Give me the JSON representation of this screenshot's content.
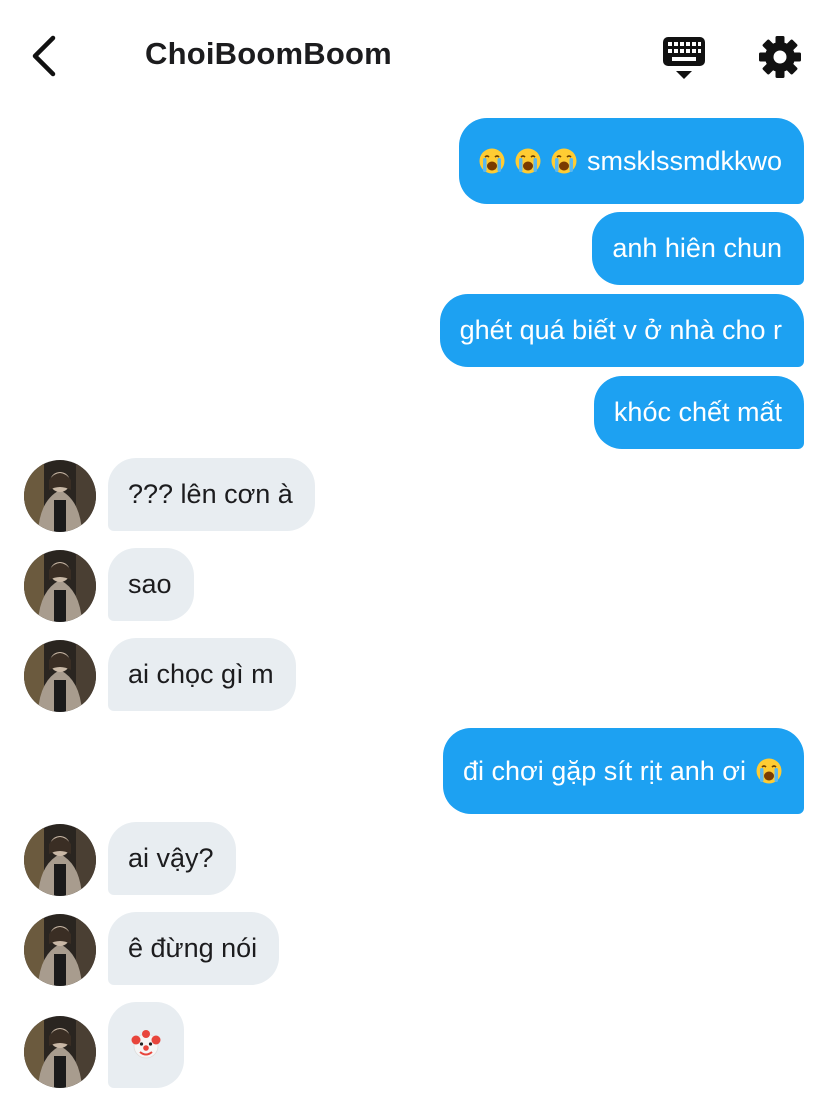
{
  "header": {
    "title": "ChoiBoomBoom"
  },
  "icons": {
    "back": "chevron-left-icon",
    "keyboard": "keyboard-icon",
    "settings": "gear-icon"
  },
  "colors": {
    "outgoing": "#1da1f2",
    "incoming": "#e8edf1"
  },
  "messages": {
    "m1": {
      "text": "smsklssmdkkwo",
      "emojis": [
        "loudly-crying-face",
        "loudly-crying-face",
        "loudly-crying-face"
      ]
    },
    "m2": {
      "text": "anh hiên chun"
    },
    "m3": {
      "text": "ghét quá biết v ở nhà cho r"
    },
    "m4": {
      "text": "khóc chết mất"
    },
    "m5": {
      "text": "??? lên cơn à"
    },
    "m6": {
      "text": "sao"
    },
    "m7": {
      "text": "ai chọc gì m"
    },
    "m8": {
      "text": "đi chơi gặp sít rịt anh ơi",
      "emojis": [
        "loudly-crying-face"
      ]
    },
    "m9": {
      "text": "ai vậy?"
    },
    "m10": {
      "text": "ê đừng nói"
    },
    "m11": {
      "emojis": [
        "clown-face"
      ]
    }
  }
}
